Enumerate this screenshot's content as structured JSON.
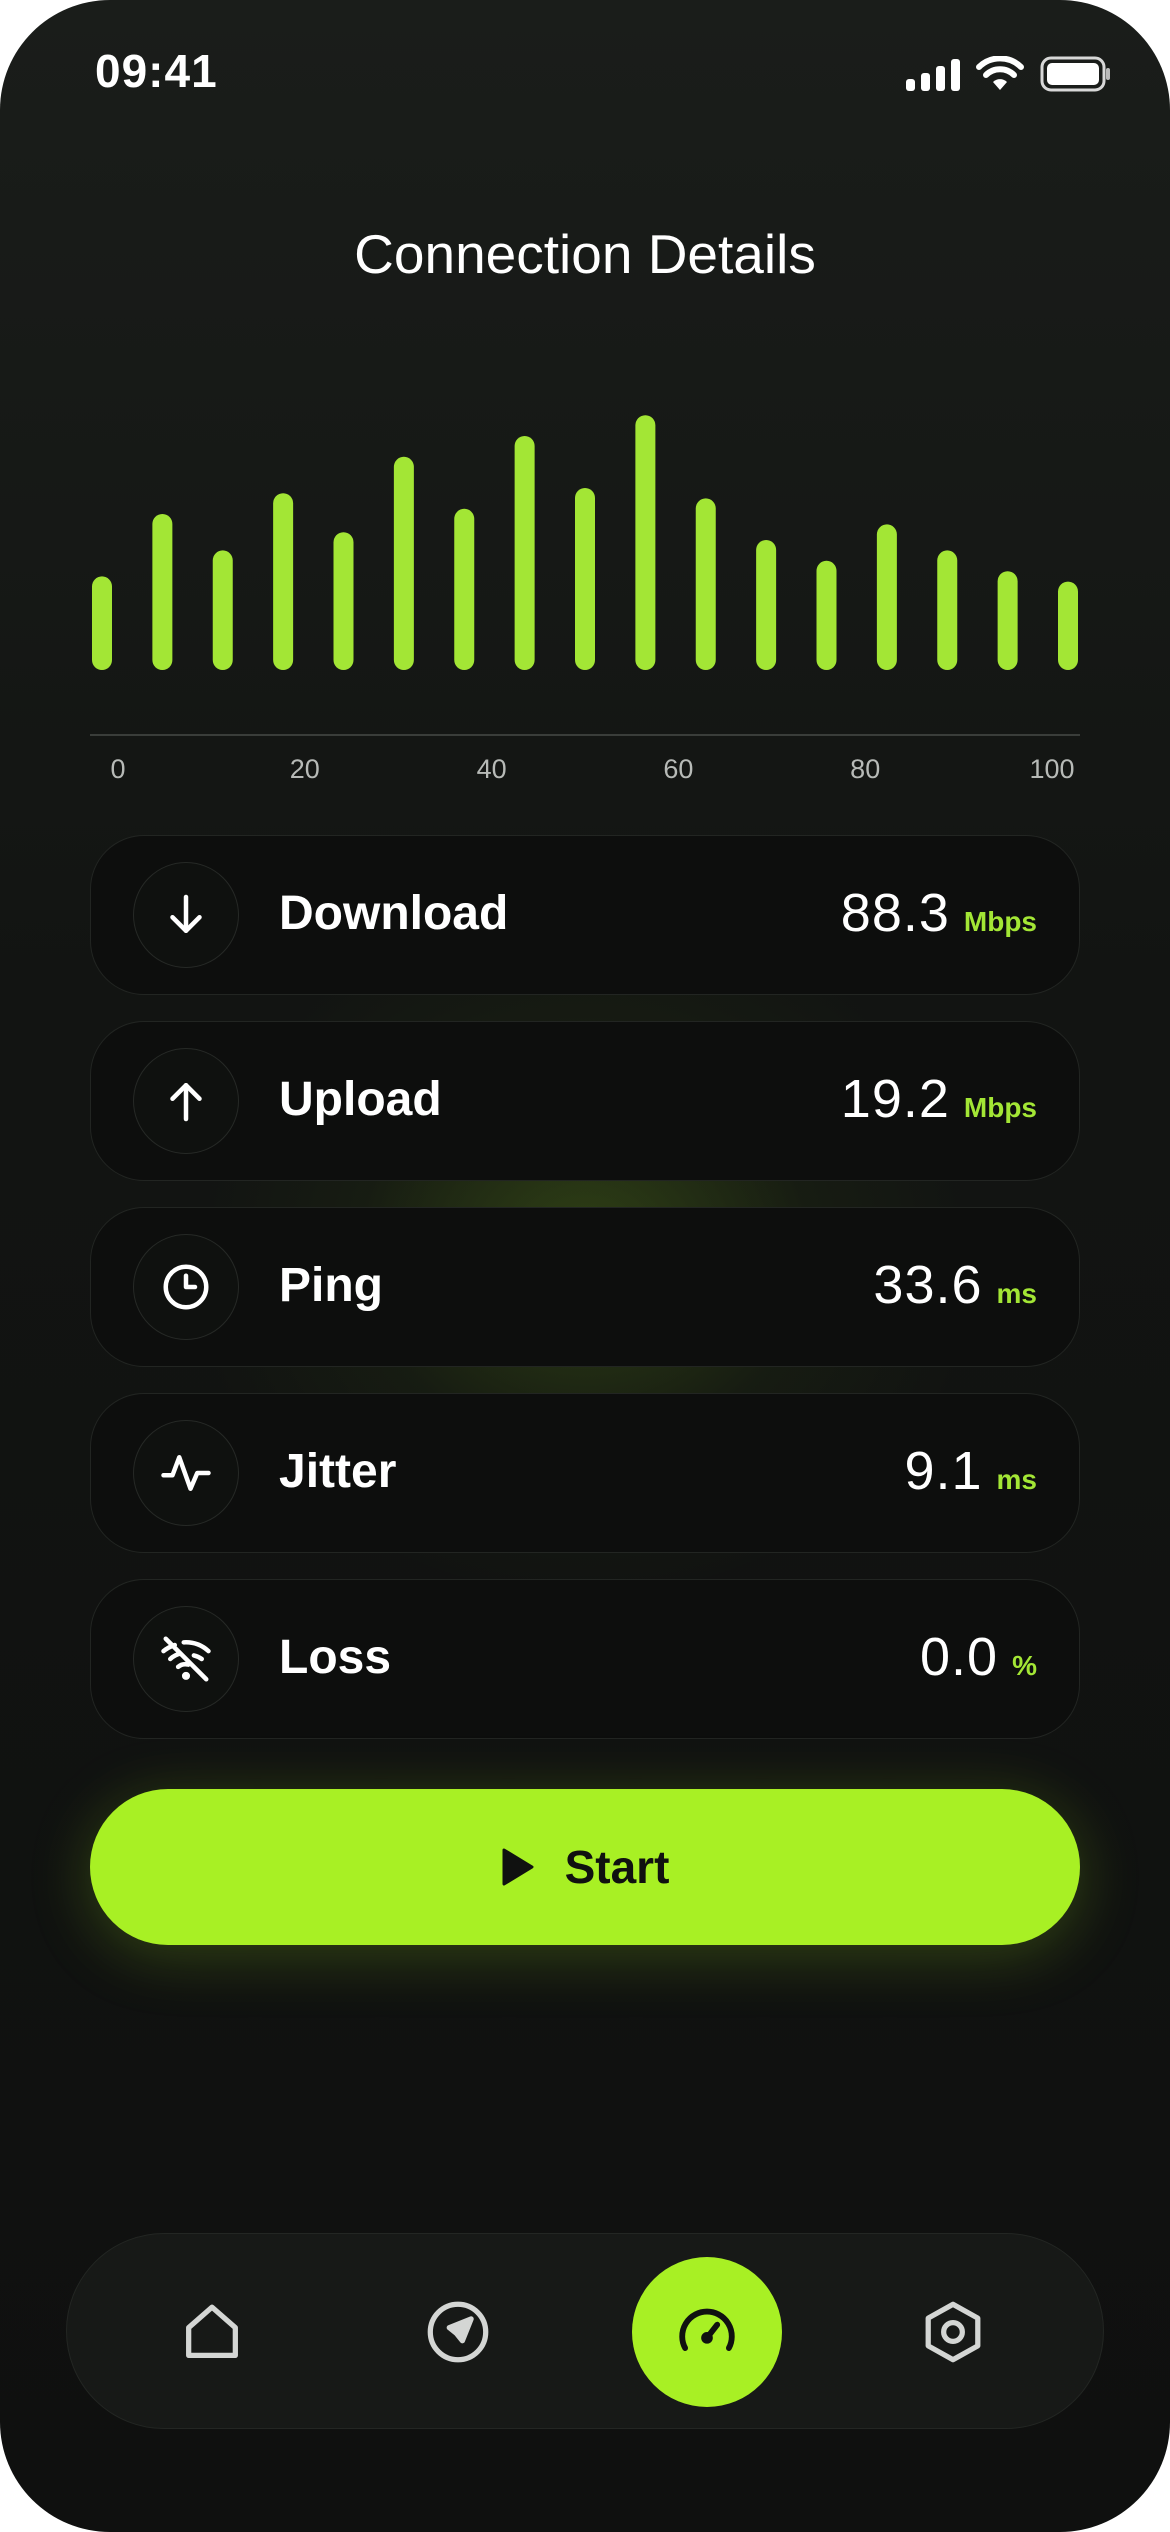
{
  "status_bar": {
    "time": "09:41"
  },
  "header": {
    "title": "Connection Details"
  },
  "chart_data": {
    "type": "bar",
    "values": [
      0.36,
      0.6,
      0.46,
      0.68,
      0.53,
      0.82,
      0.62,
      0.9,
      0.7,
      0.98,
      0.66,
      0.5,
      0.42,
      0.56,
      0.46,
      0.38,
      0.34
    ],
    "x_ticks": [
      "0",
      "20",
      "40",
      "60",
      "80",
      "100"
    ],
    "color": "#a3e635"
  },
  "metrics": [
    {
      "label": "Download",
      "value": "88.3",
      "unit": "Mbps",
      "icon": "arrow-down-icon"
    },
    {
      "label": "Upload",
      "value": "19.2",
      "unit": "Mbps",
      "icon": "arrow-up-icon"
    },
    {
      "label": "Ping",
      "value": "33.6",
      "unit": "ms",
      "icon": "clock-icon"
    },
    {
      "label": "Jitter",
      "value": "9.1",
      "unit": "ms",
      "icon": "pulse-icon"
    },
    {
      "label": "Loss",
      "value": "0.0",
      "unit": "%",
      "icon": "wifi-off-icon"
    }
  ],
  "start_button": {
    "label": "Start",
    "icon": "play-icon"
  },
  "tab_bar": {
    "items": [
      {
        "icon": "home-icon",
        "active": false
      },
      {
        "icon": "navigation-icon",
        "active": false
      },
      {
        "icon": "speedometer-icon",
        "active": true
      },
      {
        "icon": "settings-hexagon-icon",
        "active": false
      }
    ]
  },
  "colors": {
    "accent": "#a8f024",
    "background": "#121412",
    "card": "#0d0e0d"
  }
}
